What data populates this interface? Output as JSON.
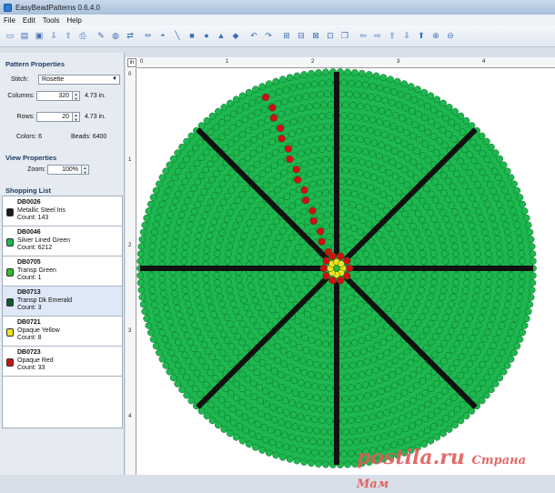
{
  "window": {
    "title": "EasyBeadPatterns 0.6.4.0"
  },
  "menu": [
    "File",
    "Edit",
    "Tools",
    "Help"
  ],
  "toolbar_icons": [
    "new-icon",
    "open-icon",
    "save-icon",
    "import-icon",
    "export-icon",
    "print-icon",
    "sep",
    "draw-icon",
    "fill-icon",
    "replace-icon",
    "sep",
    "pencil-icon",
    "bucket-icon",
    "line-icon",
    "rectangle-icon",
    "circle-icon",
    "triangle-icon",
    "diamond-icon",
    "sep",
    "undo-icon",
    "redo-icon",
    "sep",
    "insert-row-icon",
    "insert-col-icon",
    "delete-row-icon",
    "delete-col-icon",
    "copy-icon",
    "sep",
    "left-icon",
    "right-icon",
    "up-icon",
    "down-icon",
    "shift-up-icon",
    "zoom-in-icon",
    "zoom-out-icon"
  ],
  "pattern_properties": {
    "title": "Pattern Properties",
    "stitch_label": "Stitch:",
    "stitch_value": "Rosette",
    "columns_label": "Columns:",
    "columns_value": "320",
    "columns_size": "4.73 in.",
    "rows_label": "Rows:",
    "rows_value": "20",
    "rows_size": "4.73 in.",
    "colors_text": "Colors: 6",
    "beads_text": "Beads: 6400"
  },
  "view_properties": {
    "title": "View Properties",
    "zoom_label": "Zoom:",
    "zoom_value": "100%"
  },
  "shopping_list": {
    "title": "Shopping List",
    "items": [
      {
        "code": "DB0026",
        "name": "Metallic Steel Iris",
        "count": "Count: 143",
        "color": "#1a1a1a"
      },
      {
        "code": "DB0046",
        "name": "Silver Lined Green",
        "count": "Count: 6212",
        "color": "#1db84f"
      },
      {
        "code": "DB0705",
        "name": "Transp Green",
        "count": "Count: 1",
        "color": "#2bbf2b"
      },
      {
        "code": "DB0713",
        "name": "Transp Dk Emerald",
        "count": "Count: 3",
        "color": "#0f5a2a"
      },
      {
        "code": "DB0721",
        "name": "Opaque Yellow",
        "count": "Count: 8",
        "color": "#f0e020"
      },
      {
        "code": "DB0723",
        "name": "Opaque Red",
        "count": "Count: 33",
        "color": "#d01010"
      }
    ]
  },
  "ruler": {
    "corner": "in",
    "top_ticks": [
      "0",
      "1",
      "2",
      "3",
      "4"
    ],
    "left_ticks": [
      "0",
      "1",
      "2",
      "3",
      "4"
    ]
  },
  "watermark": {
    "text": "postila.ru",
    "sub": "Страна Мам"
  },
  "colors": {
    "bead_green": "#1db84f",
    "spoke_black": "#111111",
    "red": "#d01010",
    "yellow": "#f0e020"
  }
}
